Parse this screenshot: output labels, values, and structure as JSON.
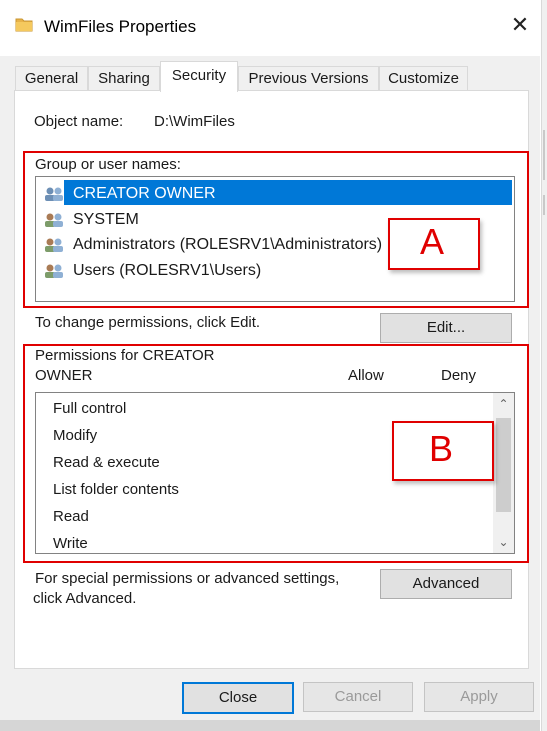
{
  "window": {
    "title": "WimFiles Properties",
    "close_glyph": "✕"
  },
  "tabs": [
    {
      "label": "General"
    },
    {
      "label": "Sharing"
    },
    {
      "label": "Security",
      "active": true
    },
    {
      "label": "Previous Versions"
    },
    {
      "label": "Customize"
    }
  ],
  "object": {
    "label": "Object name:",
    "value": "D:\\WimFiles"
  },
  "groups": {
    "label": "Group or user names:",
    "items": [
      {
        "name": "CREATOR OWNER",
        "icon": "users-group-icon",
        "selected": true
      },
      {
        "name": "SYSTEM",
        "icon": "users-group-icon"
      },
      {
        "name": "Administrators (ROLESRV1\\Administrators)",
        "icon": "users-group-icon"
      },
      {
        "name": "Users (ROLESRV1\\Users)",
        "icon": "users-group-icon"
      }
    ]
  },
  "change_text": "To change permissions, click Edit.",
  "edit_label": "Edit...",
  "permissions": {
    "label_line1": "Permissions for CREATOR",
    "label_line2": "OWNER",
    "allow": "Allow",
    "deny": "Deny",
    "items": [
      "Full control",
      "Modify",
      "Read & execute",
      "List folder contents",
      "Read",
      "Write"
    ]
  },
  "special": {
    "line1": "For special permissions or advanced settings,",
    "line2": "click Advanced.",
    "button": "Advanced"
  },
  "annotations": {
    "a": "A",
    "b": "B",
    "color": "#e00000"
  },
  "buttons": {
    "close": "Close",
    "cancel": "Cancel",
    "apply": "Apply"
  },
  "colors": {
    "selection": "#0078d7",
    "dialog_bg": "#f0f0f0"
  },
  "scroll": {
    "up_glyph": "⌃",
    "down_glyph": "⌄"
  }
}
